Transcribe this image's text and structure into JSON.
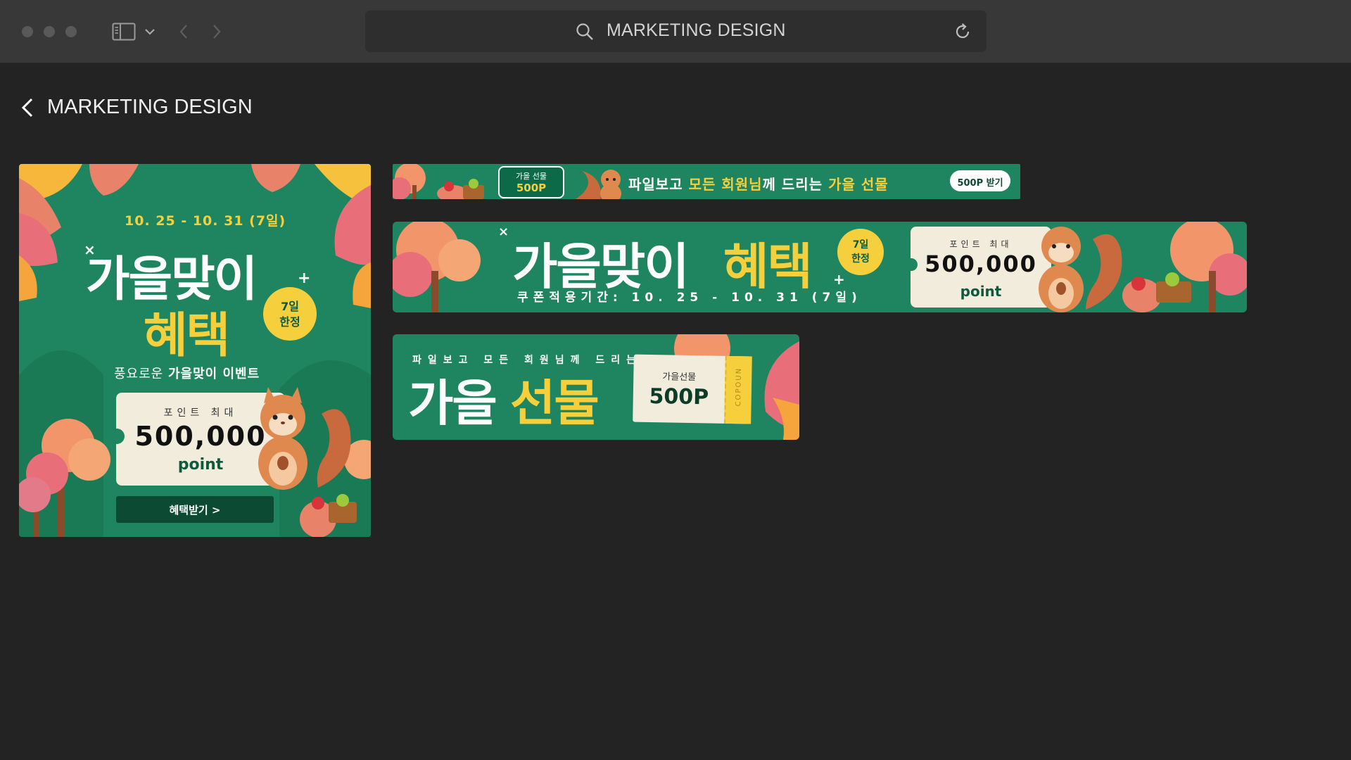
{
  "browser": {
    "address": "MARKETING DESIGN",
    "icons": [
      "sidebar-icon",
      "chevron-down-icon",
      "back-icon",
      "forward-icon",
      "search-icon",
      "reload-icon"
    ]
  },
  "page": {
    "title": "MARKETING DESIGN"
  },
  "colors": {
    "banner_green": "#1f8560",
    "accent_yellow": "#f6d03c",
    "card_cream": "#f1ecdc",
    "dark_green": "#0d3b2a"
  },
  "square_banner": {
    "date": "10. 25 - 10. 31 (7일)",
    "headline_1": "가을맞이",
    "headline_2": "혜택",
    "badge_1": "7일",
    "badge_2": "한정",
    "sub_prefix": "풍요로운 ",
    "sub_bold": "가을맞이 이벤트",
    "card_label": "포인트 최대",
    "card_value": "500,000",
    "card_unit": "point",
    "button": "혜택받기 >"
  },
  "thin_banner": {
    "ticket_1": "가을 선물",
    "ticket_2": "500P",
    "text_1": "파일보고 ",
    "text_2": "모든 회원님",
    "text_3": "께 드리는 ",
    "text_4": "가을 선물",
    "button": "500P 받기"
  },
  "wide_banner": {
    "headline_1": "가을맞이",
    "headline_2": "혜택",
    "badge_1": "7일",
    "badge_2": "한정",
    "period": "쿠폰적용기간: 10. 25 - 10. 31 (7일)",
    "card_label": "포인트 최대",
    "card_value": "500,000",
    "card_unit": "point"
  },
  "medium_banner": {
    "kicker": "파일보고 모든 회원님께 드리는",
    "headline_1": "가을",
    "headline_2": "선물",
    "coupon_label": "가을선물",
    "coupon_value": "500P",
    "coupon_side": "COPOUN"
  }
}
